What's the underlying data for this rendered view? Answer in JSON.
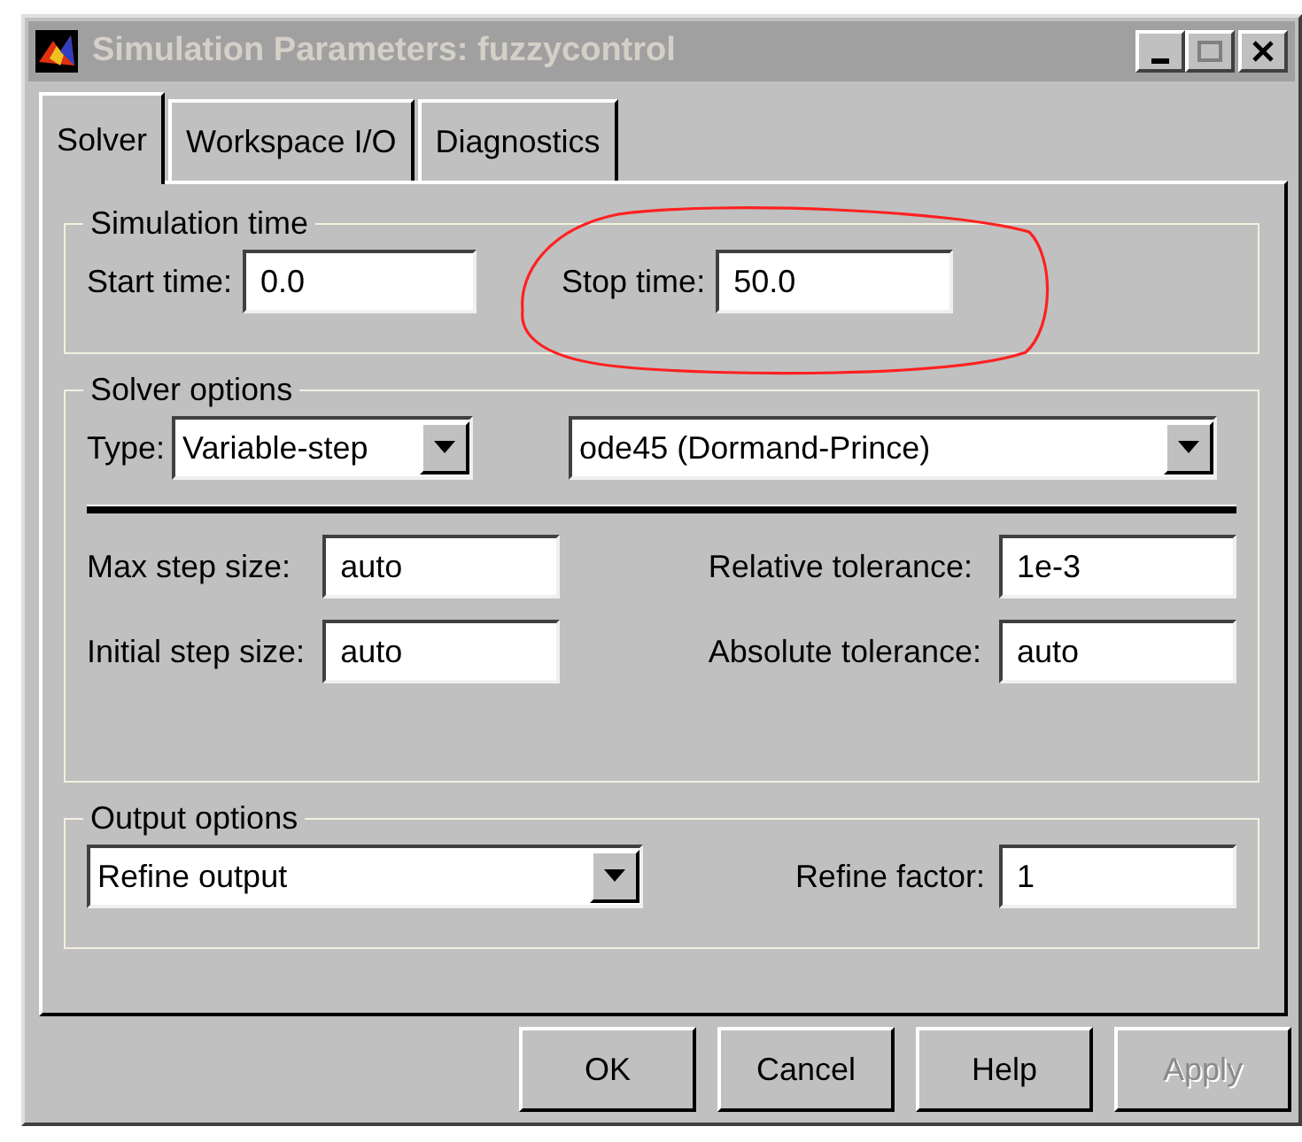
{
  "window": {
    "title": "Simulation Parameters: fuzzycontrol",
    "active": false
  },
  "tabs": [
    {
      "label": "Solver",
      "selected": true
    },
    {
      "label": "Workspace I/O",
      "selected": false
    },
    {
      "label": "Diagnostics",
      "selected": false
    }
  ],
  "simulation_time": {
    "legend": "Simulation time",
    "start_label": "Start time:",
    "start_value": "0.0",
    "stop_label": "Stop time:",
    "stop_value": "50.0",
    "stop_circled": true
  },
  "solver_options": {
    "legend": "Solver options",
    "type_label": "Type:",
    "type_value": "Variable-step",
    "solver_value": "ode45 (Dormand-Prince)",
    "fields": [
      {
        "label": "Max step size:",
        "value": "auto"
      },
      {
        "label": "Relative tolerance:",
        "value": "1e-3"
      },
      {
        "label": "Initial step size:",
        "value": "auto"
      },
      {
        "label": "Absolute tolerance:",
        "value": "auto"
      }
    ]
  },
  "output_options": {
    "legend": "Output options",
    "mode_value": "Refine output",
    "factor_label": "Refine factor:",
    "factor_value": "1"
  },
  "buttons": [
    {
      "label": "OK",
      "disabled": false
    },
    {
      "label": "Cancel",
      "disabled": false
    },
    {
      "label": "Help",
      "disabled": false
    },
    {
      "label": "Apply",
      "disabled": true
    }
  ]
}
